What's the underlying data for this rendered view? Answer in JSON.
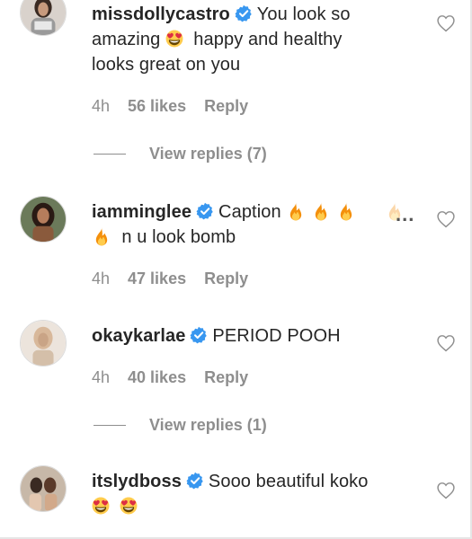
{
  "comments": [
    {
      "username": "missdollycastro",
      "text_part1": "You look so",
      "text_part2": "amazing",
      "text_part3": "happy and healthy",
      "text_part4": "looks great on you",
      "time": "4h",
      "likes": "56 likes",
      "reply_label": "Reply",
      "view_replies": "View replies (7)"
    },
    {
      "username": "iamminglee",
      "text_part1": "Caption",
      "text_part2": "n u look bomb",
      "more": "...",
      "time": "4h",
      "likes": "47 likes",
      "reply_label": "Reply"
    },
    {
      "username": "okaykarlae",
      "text_part1": "PERIOD POOH",
      "time": "4h",
      "likes": "40 likes",
      "reply_label": "Reply",
      "view_replies": "View replies (1)"
    },
    {
      "username": "itslydboss",
      "text_part1": "Sooo beautiful koko"
    }
  ],
  "colors": {
    "verified_blue": "#3897f0",
    "meta_gray": "#8e8e8e",
    "text": "#262626"
  },
  "icons": {
    "verified": "verified-badge-icon",
    "heart": "heart-outline-icon",
    "fire": "fire-emoji",
    "heart_eyes": "heart-eyes-emoji"
  }
}
